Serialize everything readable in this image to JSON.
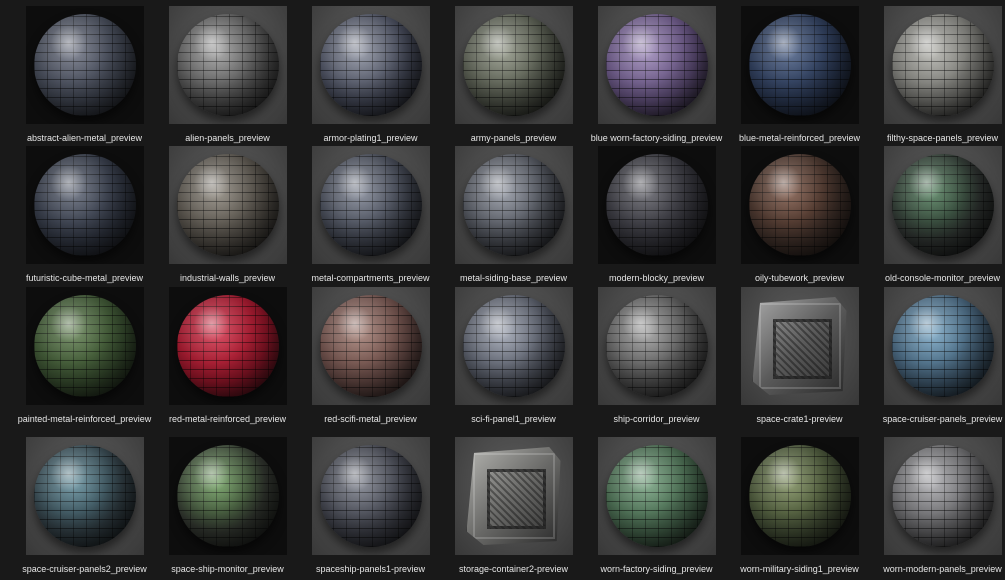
{
  "items": [
    {
      "label": "abstract-alien-metal_preview",
      "icon": "material-sphere-icon",
      "bg": "dark",
      "shape": "sphere",
      "base": "#3a3f4a",
      "accent": "#6b7080"
    },
    {
      "label": "alien-panels_preview",
      "icon": "material-sphere-icon",
      "bg": "studio",
      "shape": "sphere",
      "base": "#4a4a4a",
      "accent": "#9a9a9a"
    },
    {
      "label": "armor-plating1_preview",
      "icon": "material-sphere-icon",
      "bg": "studio",
      "shape": "sphere",
      "base": "#3e4250",
      "accent": "#8a8f9e"
    },
    {
      "label": "army-panels_preview",
      "icon": "material-sphere-icon",
      "bg": "studio",
      "shape": "sphere",
      "base": "#4a4e44",
      "accent": "#8d9282"
    },
    {
      "label": "blue worn-factory-siding_preview",
      "icon": "material-sphere-icon",
      "bg": "studio",
      "shape": "sphere",
      "base": "#5a4a72",
      "accent": "#9a86b6"
    },
    {
      "label": "blue-metal-reinforced_preview",
      "icon": "material-sphere-icon",
      "bg": "dark",
      "shape": "sphere",
      "base": "#26324a",
      "accent": "#4a5e84"
    },
    {
      "label": "filthy-space-panels_preview",
      "icon": "material-sphere-icon",
      "bg": "studio",
      "shape": "sphere",
      "base": "#6a6a66",
      "accent": "#b0b0aa"
    },
    {
      "label": "futuristic-cube-metal_preview",
      "icon": "material-sphere-icon",
      "bg": "dark",
      "shape": "sphere",
      "base": "#2c313c",
      "accent": "#5d6474"
    },
    {
      "label": "industrial-walls_preview",
      "icon": "material-sphere-icon",
      "bg": "studio",
      "shape": "sphere",
      "base": "#4a4640",
      "accent": "#8a847a"
    },
    {
      "label": "metal-compartments_preview",
      "icon": "material-sphere-icon",
      "bg": "studio",
      "shape": "sphere",
      "base": "#3a3e48",
      "accent": "#7d8392"
    },
    {
      "label": "metal-siding-base_preview",
      "icon": "material-sphere-icon",
      "bg": "studio",
      "shape": "sphere",
      "base": "#44474e",
      "accent": "#8e939e"
    },
    {
      "label": "modern-blocky_preview",
      "icon": "material-sphere-icon",
      "bg": "dark",
      "shape": "sphere",
      "base": "#2e2e34",
      "accent": "#5e5e66"
    },
    {
      "label": "oily-tubework_preview",
      "icon": "material-sphere-icon",
      "bg": "dark",
      "shape": "sphere",
      "base": "#3a2c26",
      "accent": "#7a5444"
    },
    {
      "label": "old-console-monitor_preview",
      "icon": "material-sphere-icon",
      "bg": "studio",
      "shape": "sphere",
      "base": "#2a2e2c",
      "accent": "#4e7a58"
    },
    {
      "label": "painted-metal-reinforced_preview",
      "icon": "material-sphere-icon",
      "bg": "dark",
      "shape": "sphere",
      "base": "#34482c",
      "accent": "#5e7c4e"
    },
    {
      "label": "red-metal-reinforced_preview",
      "icon": "material-sphere-icon",
      "bg": "dark",
      "shape": "sphere",
      "base": "#8a1426",
      "accent": "#d03048"
    },
    {
      "label": "red-scifi-metal_preview",
      "icon": "material-sphere-icon",
      "bg": "studio",
      "shape": "sphere",
      "base": "#5e4440",
      "accent": "#a07a70"
    },
    {
      "label": "sci-fi-panel1_preview",
      "icon": "material-sphere-icon",
      "bg": "studio",
      "shape": "sphere",
      "base": "#4a4e58",
      "accent": "#9aa0ae"
    },
    {
      "label": "ship-corridor_preview",
      "icon": "material-sphere-icon",
      "bg": "studio",
      "shape": "sphere",
      "base": "#4c4c4c",
      "accent": "#9a9a9a"
    },
    {
      "label": "space-crate1-preview",
      "icon": "material-cube-icon",
      "bg": "studio",
      "shape": "cube",
      "base": "#5a5a5a",
      "accent": "#a8a8a8"
    },
    {
      "label": "space-cruiser-panels_preview",
      "icon": "material-sphere-icon",
      "bg": "studio",
      "shape": "sphere",
      "base": "#3c5468",
      "accent": "#74a2c0"
    },
    {
      "label": "space-cruiser-panels2_preview",
      "icon": "material-sphere-icon",
      "bg": "studio",
      "shape": "sphere",
      "base": "#2e3a40",
      "accent": "#5e8a98"
    },
    {
      "label": "space-ship-monitor_preview",
      "icon": "material-sphere-icon",
      "bg": "dark",
      "shape": "sphere",
      "base": "#2e322c",
      "accent": "#6a9a5a"
    },
    {
      "label": "spaceship-panels1-preview",
      "icon": "material-sphere-icon",
      "bg": "studio",
      "shape": "sphere",
      "base": "#383a42",
      "accent": "#7a7e8a"
    },
    {
      "label": "storage-container2-preview",
      "icon": "material-cube-icon",
      "bg": "studio",
      "shape": "cube",
      "base": "#6a6a68",
      "accent": "#b4b4b0"
    },
    {
      "label": "worn-factory-siding_preview",
      "icon": "material-sphere-icon",
      "bg": "studio",
      "shape": "sphere",
      "base": "#3e5a44",
      "accent": "#74a07e"
    },
    {
      "label": "worn-military-siding1_preview",
      "icon": "material-sphere-icon",
      "bg": "dark",
      "shape": "sphere",
      "base": "#3c4630",
      "accent": "#7a8a5a"
    },
    {
      "label": "worn-modern-panels_preview",
      "icon": "material-sphere-icon",
      "bg": "studio",
      "shape": "sphere",
      "base": "#5a5a5c",
      "accent": "#a6a6aa"
    }
  ]
}
